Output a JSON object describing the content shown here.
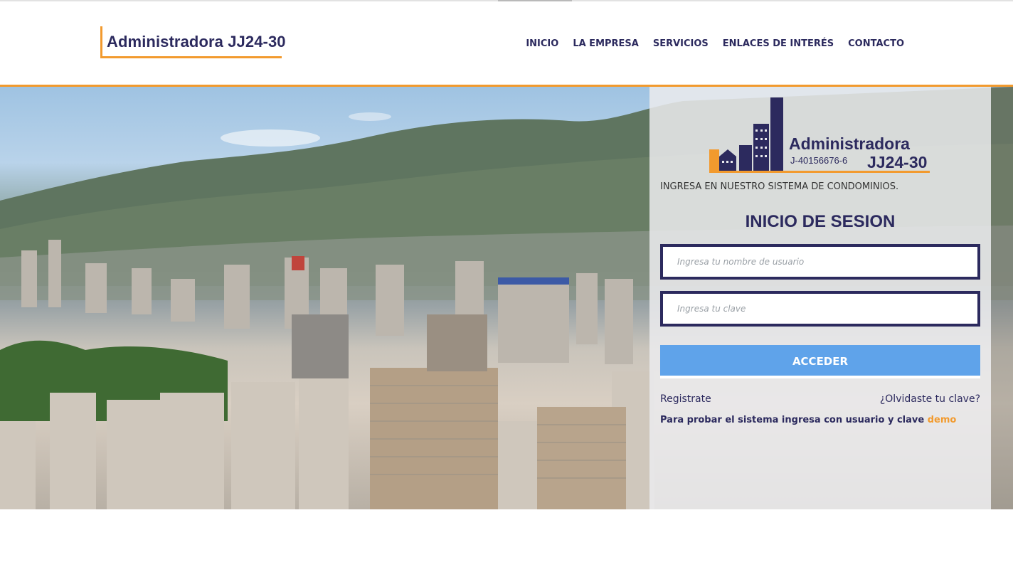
{
  "header": {
    "brand": "Administradora JJ24-30",
    "nav": [
      "INICIO",
      "LA EMPRESA",
      "SERVICIOS",
      "ENLACES DE INTERÉS",
      "CONTACTO"
    ]
  },
  "login": {
    "logo": {
      "name": "Administradora",
      "rif": "J-40156676-6",
      "code": "JJ24-30"
    },
    "tagline": "INGRESA EN NUESTRO SISTEMA DE CONDOMINIOS.",
    "title": "INICIO DE SESION",
    "username_placeholder": "Ingresa tu nombre de usuario",
    "password_placeholder": "Ingresa tu clave",
    "submit_label": "ACCEDER",
    "register_label": "Registrate",
    "forgot_label": "¿Olvidaste tu clave?",
    "demo_text": "Para probar el sistema ingresa con usuario y clave",
    "demo_word": "demo"
  },
  "colors": {
    "navy": "#2c2a5e",
    "orange": "#f29a2e",
    "button": "#5fa3ea"
  }
}
